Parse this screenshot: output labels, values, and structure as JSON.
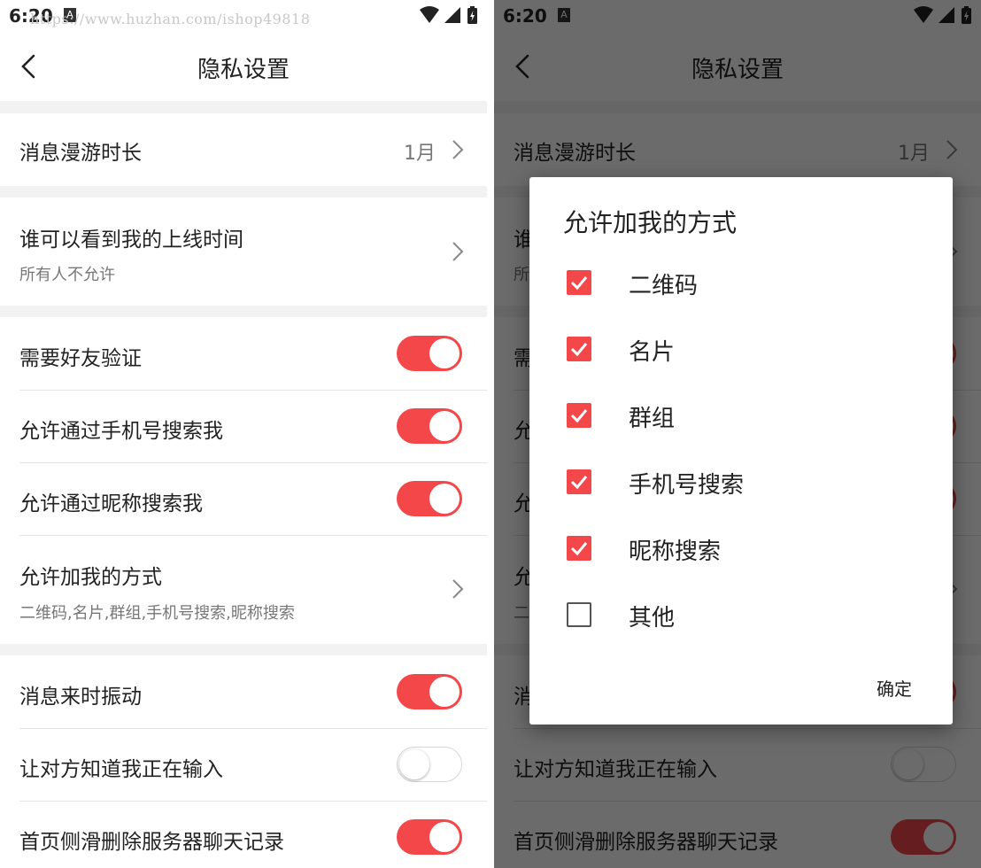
{
  "status": {
    "time": "6:20",
    "notification_badge": "A",
    "watermark": "https://www.huzhan.com/ishop49818",
    "icons": [
      "wifi-icon",
      "signal-icon",
      "battery-charging-icon"
    ]
  },
  "header": {
    "title": "隐私设置",
    "back_icon": "chevron-left-icon"
  },
  "settings": {
    "roaming": {
      "title": "消息漫游时长",
      "value": "1月"
    },
    "online_time": {
      "title": "谁可以看到我的上线时间",
      "subtitle": "所有人不允许"
    },
    "friend_verify": {
      "title": "需要好友验证",
      "on": true
    },
    "search_by_phone": {
      "title": "允许通过手机号搜索我",
      "on": true
    },
    "search_by_nickname": {
      "title": "允许通过昵称搜索我",
      "on": true
    },
    "add_methods": {
      "title": "允许加我的方式",
      "subtitle": "二维码,名片,群组,手机号搜索,昵称搜索"
    },
    "vibrate": {
      "title": "消息来时振动",
      "on": true
    },
    "typing_status": {
      "title": "让对方知道我正在输入",
      "on": false
    },
    "swipe_delete": {
      "title": "首页侧滑删除服务器聊天记录",
      "on": true
    }
  },
  "dialog": {
    "title": "允许加我的方式",
    "options": [
      {
        "label": "二维码",
        "checked": true
      },
      {
        "label": "名片",
        "checked": true
      },
      {
        "label": "群组",
        "checked": true
      },
      {
        "label": "手机号搜索",
        "checked": true
      },
      {
        "label": "昵称搜索",
        "checked": true
      },
      {
        "label": "其他",
        "checked": false
      }
    ],
    "confirm_label": "确定"
  },
  "colors": {
    "accent": "#f4474a",
    "background": "#f2f2f2",
    "text": "#222222",
    "secondary_text": "#777777"
  }
}
